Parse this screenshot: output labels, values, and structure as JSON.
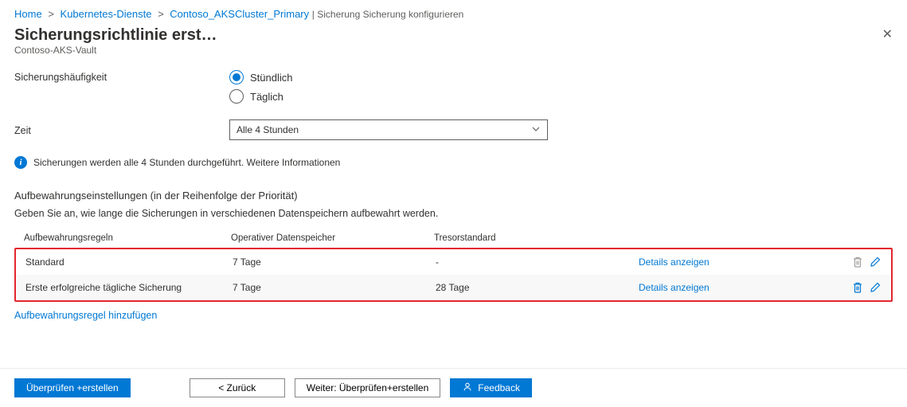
{
  "breadcrumb": {
    "home": "Home",
    "item1": "Kubernetes-Dienste",
    "item2": "Contoso_AKSCluster_Primary",
    "tail": "Sicherung Sicherung konfigurieren"
  },
  "header": {
    "title": "Sicherungsrichtlinie erstellen",
    "subtitle": "Contoso-AKS-Vault"
  },
  "form": {
    "frequency_label": "Sicherungshäufigkeit",
    "frequency_options": {
      "hourly": "Stündlich",
      "daily": "Täglich"
    },
    "time_label": "Zeit",
    "time_value": "Alle 4 Stunden",
    "info_text": "Sicherungen werden alle 4 Stunden durchgeführt. Weitere Informationen"
  },
  "retention": {
    "section_title": "Aufbewahrungseinstellungen (in der Reihenfolge der Priorität)",
    "section_desc": "Geben Sie an, wie lange die Sicherungen in verschiedenen Datenspeichern aufbewahrt werden.",
    "headers": {
      "name": "Aufbewahrungsregeln",
      "operational": "Operativer Datenspeicher",
      "vault": "Tresorstandard"
    },
    "rows": [
      {
        "name": "Standard",
        "operational": "7 Tage",
        "vault": "-",
        "details": "Details anzeigen"
      },
      {
        "name": "Erste erfolgreiche tägliche Sicherung",
        "operational": "7 Tage",
        "vault": "28 Tage",
        "details": "Details anzeigen"
      }
    ],
    "add_rule": "Aufbewahrungsregel hinzufügen"
  },
  "footer": {
    "review_create": "Überprüfen +erstellen",
    "back": "<  Zurück",
    "next": "Weiter: Überprüfen+erstellen",
    "feedback": "Feedback"
  }
}
